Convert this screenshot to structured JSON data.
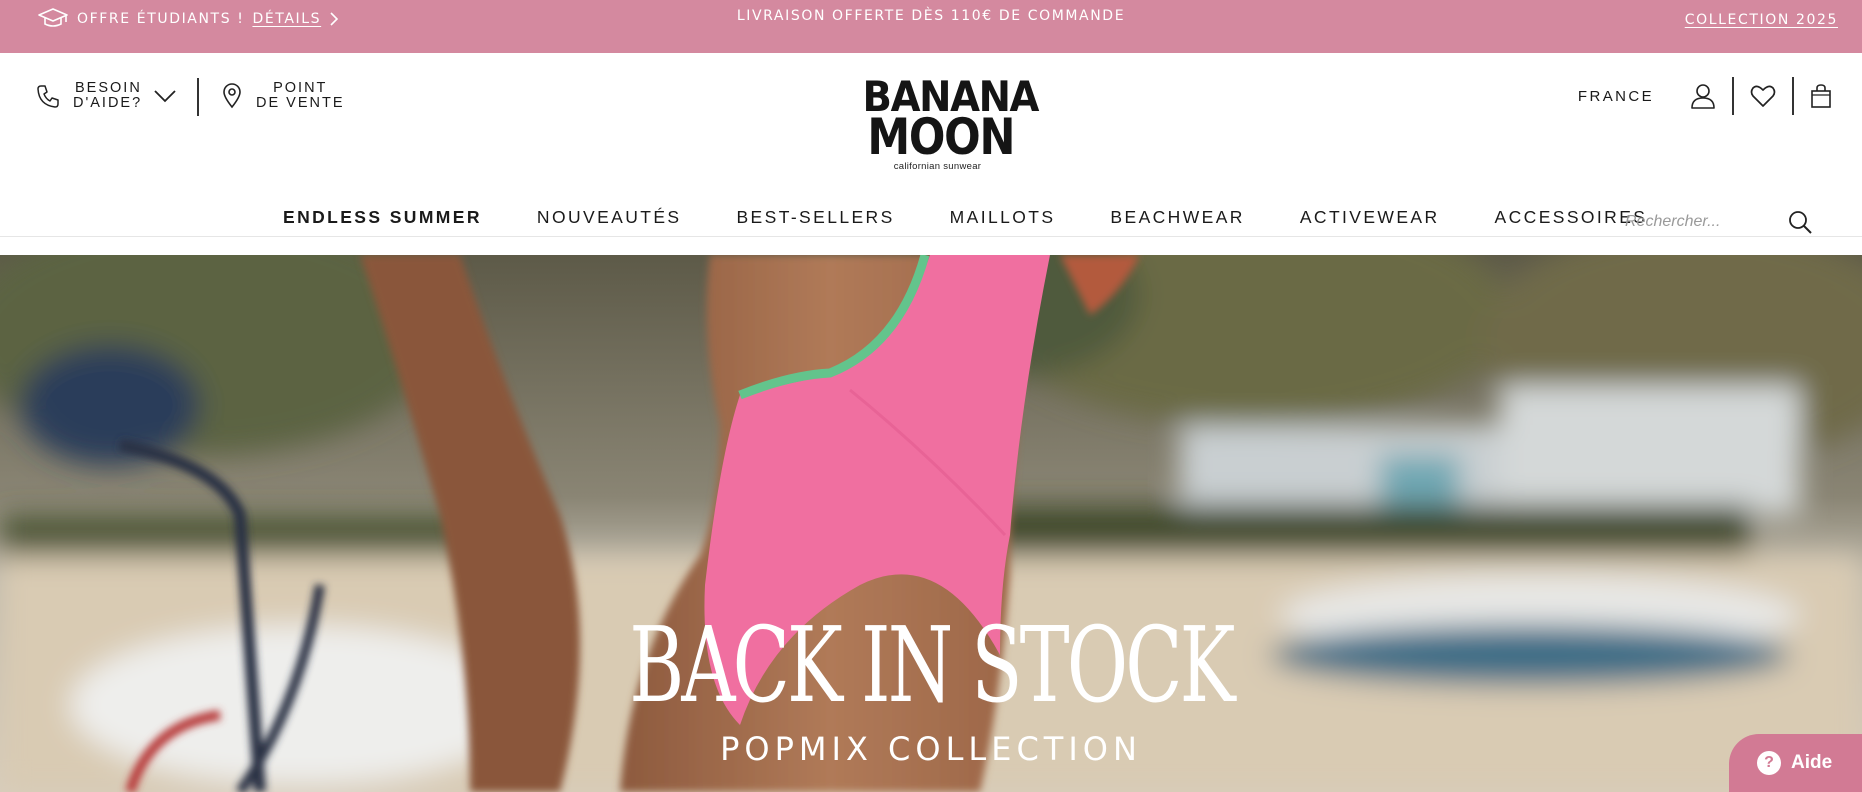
{
  "promo": {
    "student_text": "OFFRE ÉTUDIANTS !",
    "student_link": "DÉTAILS",
    "shipping": "LIVRAISON OFFERTE DÈS 110€ DE COMMANDE",
    "collection": "COLLECTION 2025",
    "background_color": "#d4899f"
  },
  "header": {
    "help_line1": "BESOIN",
    "help_line2": "D'AIDE?",
    "store_line1": "POINT",
    "store_line2": "DE VENTE",
    "logo_line1": "BANANA",
    "logo_line2": "MOON",
    "logo_tagline": "californian sunwear",
    "country": "FRANCE",
    "icons": [
      "phone-icon",
      "chevron-down-icon",
      "map-pin-icon",
      "user-icon",
      "heart-icon",
      "bag-icon"
    ]
  },
  "nav": {
    "items": [
      {
        "label": "ENDLESS SUMMER"
      },
      {
        "label": "NOUVEAUTÉS"
      },
      {
        "label": "BEST-SELLERS"
      },
      {
        "label": "MAILLOTS"
      },
      {
        "label": "BEACHWEAR"
      },
      {
        "label": "ACTIVEWEAR"
      },
      {
        "label": "ACCESSOIRES"
      }
    ],
    "search_placeholder": "Rechercher..."
  },
  "hero": {
    "title": "BACK IN STOCK",
    "subtitle": "POPMIX COLLECTION"
  },
  "help_widget": {
    "label": "Aide",
    "color": "#d27a94"
  }
}
